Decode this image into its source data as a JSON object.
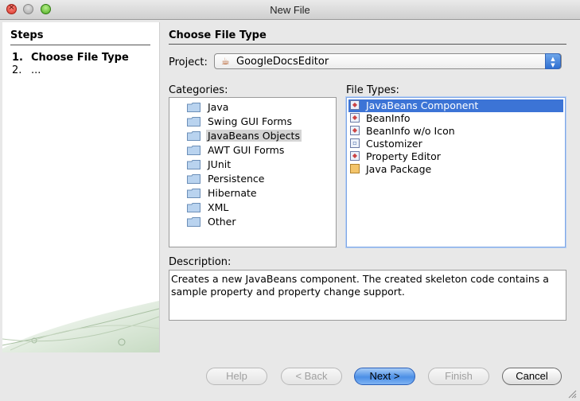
{
  "window": {
    "title": "New File"
  },
  "steps": {
    "heading": "Steps",
    "items": [
      {
        "num": "1.",
        "label": "Choose File Type"
      },
      {
        "num": "2.",
        "label": "..."
      }
    ]
  },
  "main": {
    "title": "Choose File Type",
    "project_label": "Project:",
    "project_value": "GoogleDocsEditor",
    "categories_label": "Categories:",
    "categories": [
      "Java",
      "Swing GUI Forms",
      "JavaBeans Objects",
      "AWT GUI Forms",
      "JUnit",
      "Persistence",
      "Hibernate",
      "XML",
      "Other"
    ],
    "selected_category": "JavaBeans Objects",
    "file_types_label": "File Types:",
    "file_types": [
      {
        "label": "JavaBeans Component",
        "icon": "bean-file-icon"
      },
      {
        "label": "BeanInfo",
        "icon": "bean-file-icon"
      },
      {
        "label": "BeanInfo w/o Icon",
        "icon": "bean-file-icon"
      },
      {
        "label": "Customizer",
        "icon": "form-file-icon"
      },
      {
        "label": "Property Editor",
        "icon": "bean-file-icon"
      },
      {
        "label": "Java Package",
        "icon": "package-icon"
      }
    ],
    "selected_file_type": "JavaBeans Component",
    "description_label": "Description:",
    "description": "Creates a new JavaBeans component. The created skeleton code contains a sample property and property change support."
  },
  "buttons": {
    "help": "Help",
    "back": "< Back",
    "next": "Next >",
    "finish": "Finish",
    "cancel": "Cancel"
  },
  "colors": {
    "selection": "#3c74d6",
    "default_button": "#4c8fe6"
  }
}
